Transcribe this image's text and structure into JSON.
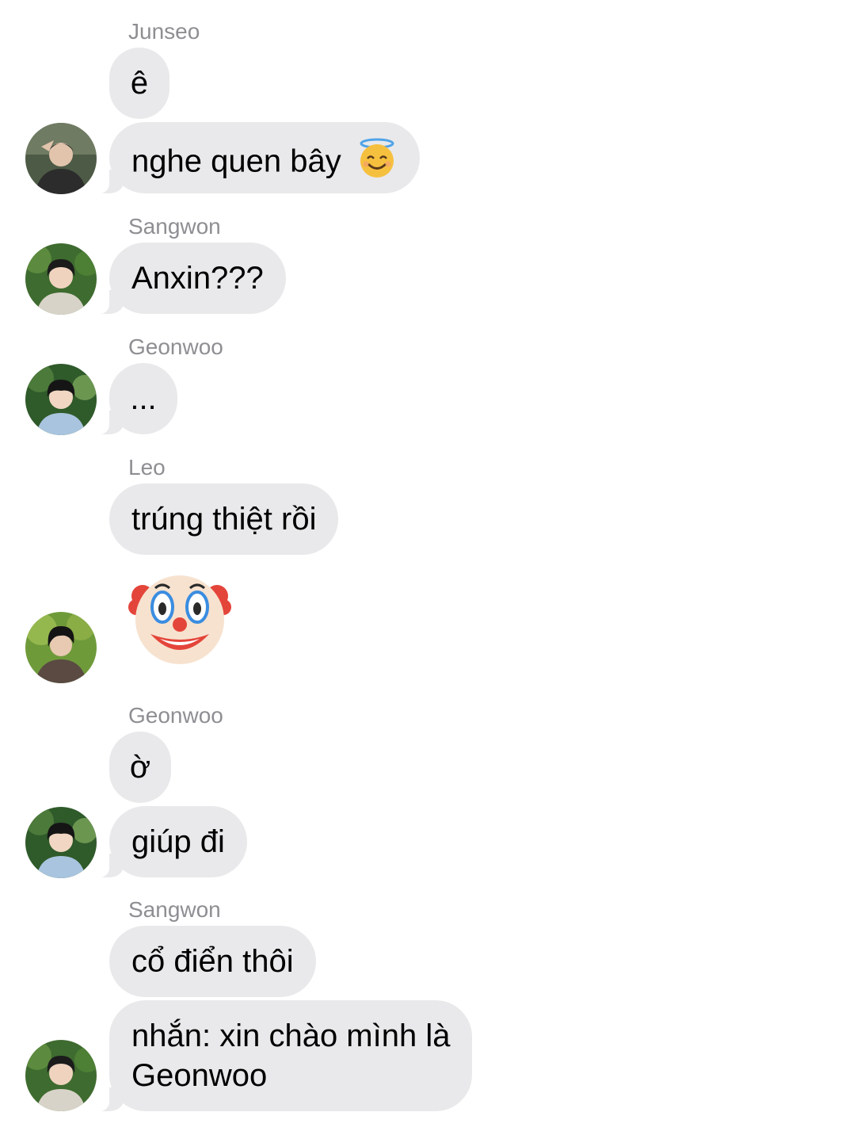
{
  "messages": [
    {
      "sender": "Junseo",
      "lines": [
        "ê",
        "nghe quen bây"
      ],
      "emoji": "smiling-face-with-halo"
    },
    {
      "sender": "Sangwon",
      "text": "Anxin???"
    },
    {
      "sender": "Geonwoo",
      "text": "..."
    },
    {
      "sender": "Leo",
      "text": "trúng thiệt rồi",
      "emoji": "clown-face"
    },
    {
      "sender": "Geonwoo",
      "lines": [
        "ờ",
        "giúp đi"
      ]
    },
    {
      "sender": "Sangwon",
      "lines": [
        "cổ điển thôi",
        "nhắn: xin chào mình là",
        "Geonwoo"
      ]
    }
  ],
  "colors": {
    "bubble": "#e9e9eb",
    "sender_name": "#8e8e93",
    "background": "#ffffff"
  }
}
